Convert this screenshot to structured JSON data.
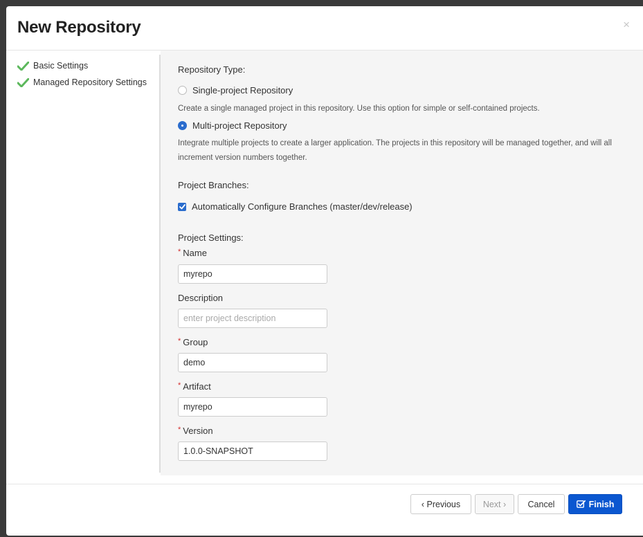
{
  "dialog": {
    "title": "New Repository",
    "close_glyph": "×"
  },
  "steps": [
    {
      "label": "Basic Settings",
      "icon": "check-icon",
      "status": "complete"
    },
    {
      "label": "Managed Repository Settings",
      "icon": "check-icon",
      "status": "complete"
    }
  ],
  "repository_type": {
    "title": "Repository Type:",
    "options": [
      {
        "label": "Single-project Repository",
        "checked": false,
        "description": "Create a single managed project in this repository. Use this option for simple or self-contained projects."
      },
      {
        "label": "Multi-project Repository",
        "checked": true,
        "description": "Integrate multiple projects to create a larger application. The projects in this repository will be managed together, and will all increment version numbers together."
      }
    ]
  },
  "project_branches": {
    "title": "Project Branches:",
    "auto_configure_label": "Automatically Configure Branches (master/dev/release)",
    "auto_configure_checked": true
  },
  "project_settings": {
    "title": "Project Settings:",
    "name": {
      "label": "Name",
      "required": true,
      "value": "myrepo"
    },
    "description": {
      "label": "Description",
      "required": false,
      "value": "",
      "placeholder": "enter project description"
    },
    "group": {
      "label": "Group",
      "required": true,
      "value": "demo"
    },
    "artifact": {
      "label": "Artifact",
      "required": true,
      "value": "myrepo"
    },
    "version": {
      "label": "Version",
      "required": true,
      "value": "1.0.0-SNAPSHOT"
    }
  },
  "footer": {
    "previous_label": "‹ Previous",
    "next_label": "Next ›",
    "cancel_label": "Cancel",
    "finish_label": "Finish",
    "next_disabled": true
  },
  "colors": {
    "accent": "#0b57d0",
    "check_green": "#5cb85c",
    "required_asterisk": "#d32f2f",
    "panel_bg": "#f5f5f5"
  }
}
